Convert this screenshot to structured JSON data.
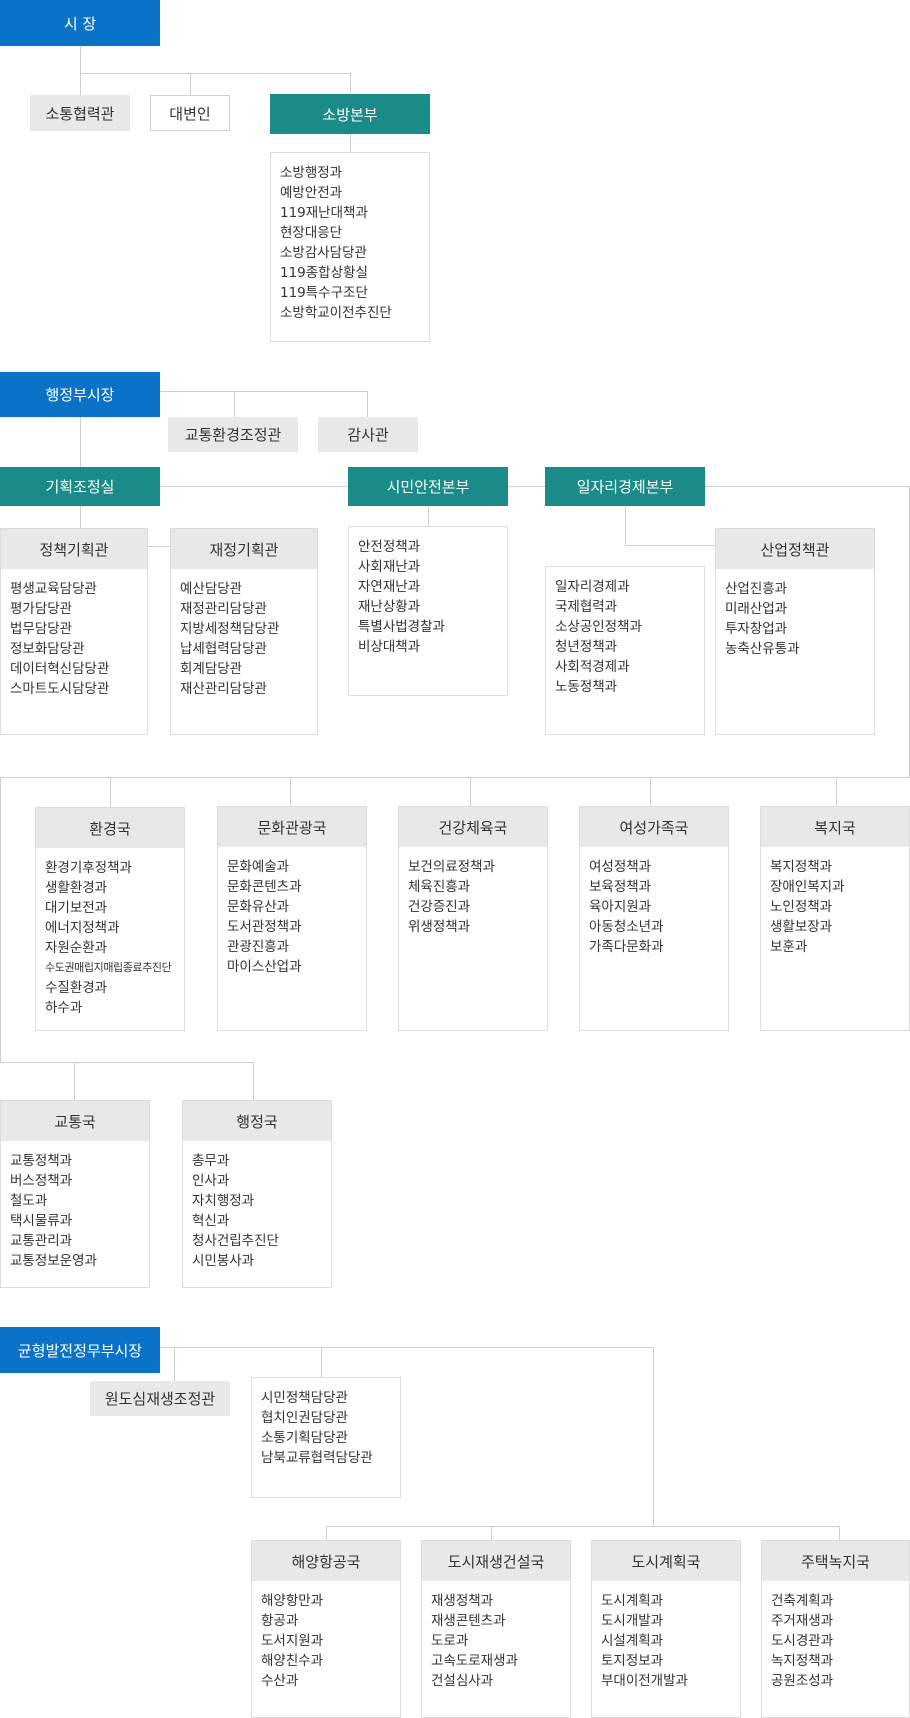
{
  "mayor": {
    "label": "시 장"
  },
  "mayor_staff": [
    {
      "key": "communication",
      "label": "소통협력관"
    },
    {
      "key": "spokesperson",
      "label": "대변인"
    }
  ],
  "fire_hq": {
    "label": "소방본부",
    "items": [
      "소방행정과",
      "예방안전과",
      "119재난대책과",
      "현장대응단",
      "소방감사담당관",
      "119종합상황실",
      "119특수구조단",
      "소방학교이전추진단"
    ]
  },
  "admin_vice_mayor": {
    "label": "행정부시장"
  },
  "admin_staff": [
    {
      "key": "traffic-env",
      "label": "교통환경조정관"
    },
    {
      "key": "audit",
      "label": "감사관"
    }
  ],
  "planning_office": {
    "label": "기획조정실"
  },
  "citizen_safety_hq": {
    "label": "시민안전본부",
    "items": [
      "안전정책과",
      "사회재난과",
      "자연재난과",
      "재난상황과",
      "특별사법경찰과",
      "비상대책과"
    ]
  },
  "jobs_economy_hq": {
    "label": "일자리경제본부",
    "items": [
      "일자리경제과",
      "국제협력과",
      "소상공인정책과",
      "청년정책과",
      "사회적경제과",
      "노동정책과"
    ]
  },
  "policy_planning": {
    "label": "정책기획관",
    "items": [
      "평생교육담당관",
      "평가담당관",
      "법무담당관",
      "정보화담당관",
      "데이터혁신담당관",
      "스마트도시담당관"
    ]
  },
  "finance_planning": {
    "label": "재정기획관",
    "items": [
      "예산담당관",
      "재정관리담당관",
      "지방세정책담당관",
      "납세협력담당관",
      "회계담당관",
      "재산관리담당관"
    ]
  },
  "industry_policy": {
    "label": "산업정책관",
    "items": [
      "산업진흥과",
      "미래산업과",
      "투자창업과",
      "농축산유통과"
    ]
  },
  "environment": {
    "label": "환경국",
    "items": [
      "환경기후정책과",
      "생활환경과",
      "대기보전과",
      "에너지정책과",
      "자원순환과",
      "수도권매립지매립종료추진단",
      "수질환경과",
      "하수과"
    ]
  },
  "culture_tourism": {
    "label": "문화관광국",
    "items": [
      "문화예술과",
      "문화콘텐츠과",
      "문화유산과",
      "도서관정책과",
      "관광진흥과",
      "마이스산업과"
    ]
  },
  "health_sports": {
    "label": "건강체육국",
    "items": [
      "보건의료정책과",
      "체육진흥과",
      "건강증진과",
      "위생정책과"
    ]
  },
  "women_family": {
    "label": "여성가족국",
    "items": [
      "여성정책과",
      "보육정책과",
      "육아지원과",
      "아동청소년과",
      "가족다문화과"
    ]
  },
  "welfare": {
    "label": "복지국",
    "items": [
      "복지정책과",
      "장애인복지과",
      "노인정책과",
      "생활보장과",
      "보훈과"
    ]
  },
  "transport": {
    "label": "교통국",
    "items": [
      "교통정책과",
      "버스정책과",
      "철도과",
      "택시물류과",
      "교통관리과",
      "교통정보운영과"
    ]
  },
  "administration": {
    "label": "행정국",
    "items": [
      "총무과",
      "인사과",
      "자치행정과",
      "혁신과",
      "청사건립추진단",
      "시민봉사과"
    ]
  },
  "balanced_vice_mayor": {
    "label": "균형발전정무부시장"
  },
  "balanced_staff": {
    "label": "원도심재생조정관"
  },
  "balanced_officers": {
    "items": [
      "시민정책담당관",
      "협치인권담당관",
      "소통기획담당관",
      "남북교류협력담당관"
    ]
  },
  "ocean_port": {
    "label": "해양항공국",
    "items": [
      "해양항만과",
      "항공과",
      "도서지원과",
      "해양친수과",
      "수산과"
    ]
  },
  "urban_regen": {
    "label": "도시재생건설국",
    "items": [
      "재생정책과",
      "재생콘텐츠과",
      "도로과",
      "고속도로재생과",
      "건설심사과"
    ]
  },
  "urban_planning": {
    "label": "도시계획국",
    "items": [
      "도시계획과",
      "도시개발과",
      "시설계획과",
      "토지정보과",
      "부대이전개발과"
    ]
  },
  "housing_green": {
    "label": "주택녹지국",
    "items": [
      "건축계획과",
      "주거재생과",
      "도시경관과",
      "녹지정책과",
      "공원조성과"
    ]
  },
  "colors": {
    "blue": "#0a73c8",
    "teal": "#1a8b88",
    "grey": "#e8e8e8",
    "line": "#cfcfcf"
  }
}
